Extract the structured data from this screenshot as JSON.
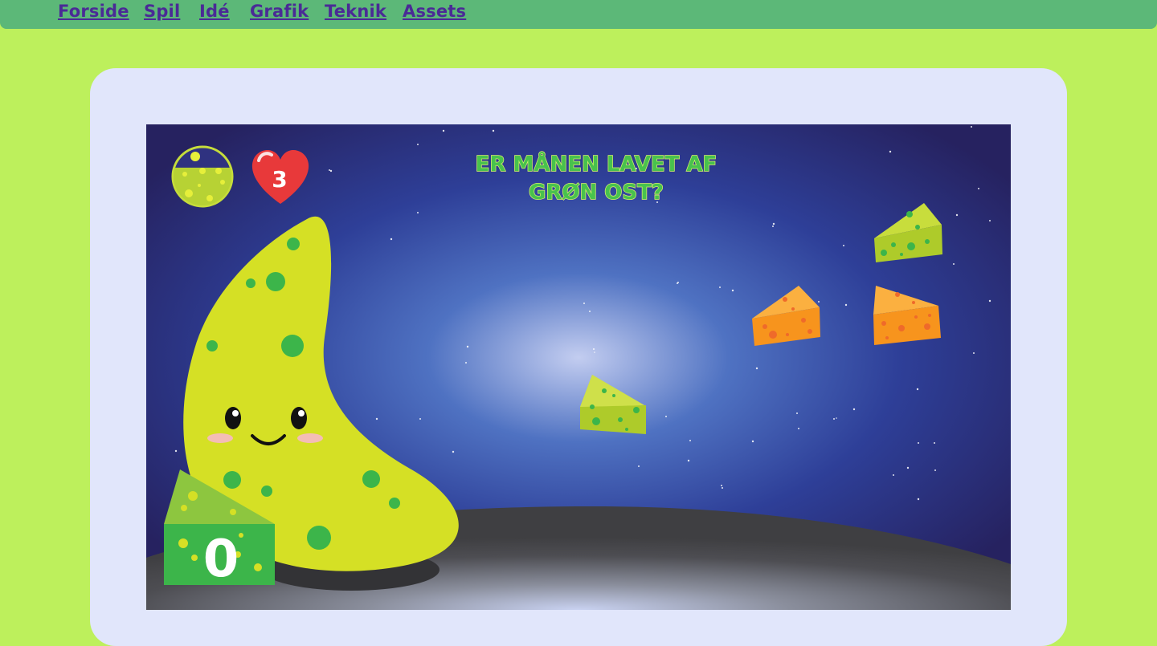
{
  "nav": {
    "links": [
      "Forside",
      "Spil",
      "Idé",
      "Grafik",
      "Teknik",
      "Assets"
    ]
  },
  "game": {
    "title_line1": "ER MÅNEN LAVET AF",
    "title_line2": "GRØN OST?",
    "lives": "3",
    "score": "0",
    "time_fill": 0.65
  },
  "colors": {
    "page_bg": "#bdf05c",
    "nav_bg": "#5cb878",
    "nav_link": "#4a2a96",
    "frame_bg": "#e1e6fb",
    "space_dark": "#2a2568",
    "space_glow": "#aebbe8",
    "ground": "#4a4a4a",
    "moon": "#d5e025",
    "green_spot": "#3cb54a",
    "heart": "#e8393a",
    "title_green": "#48c24d",
    "orange_cheese": "#f7941d"
  },
  "icons": {
    "timer": "cheese-timer-icon",
    "lives": "heart-icon",
    "score": "cheese-block-icon"
  }
}
